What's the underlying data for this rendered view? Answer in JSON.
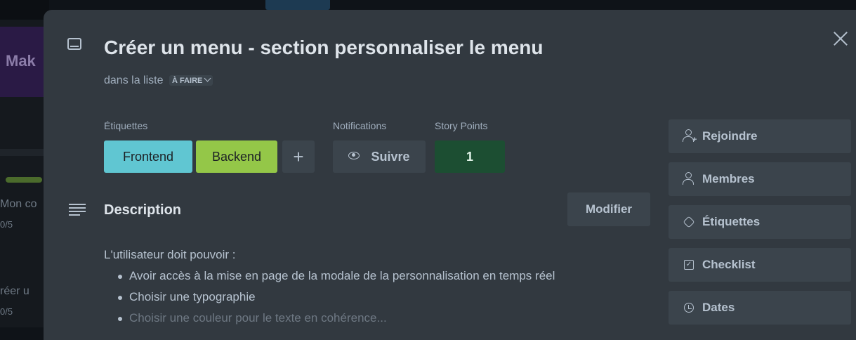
{
  "background": {
    "board_title": "Mak",
    "card1_title": "Mon co",
    "card1_count": "0/5",
    "card2_title": "réer u",
    "card2_count": "0/5"
  },
  "card": {
    "title": "Créer un menu - section personnaliser le menu",
    "in_list_prefix": "dans la liste",
    "list_name": "À FAIRE"
  },
  "labels_section": {
    "heading": "Étiquettes",
    "labels": [
      {
        "text": "Frontend",
        "color": "#60c6d2"
      },
      {
        "text": "Backend",
        "color": "#94c748"
      }
    ],
    "add_symbol": "+"
  },
  "notifications": {
    "heading": "Notifications",
    "follow_label": "Suivre"
  },
  "story_points": {
    "heading": "Story Points",
    "value": "1"
  },
  "description": {
    "heading": "Description",
    "edit_label": "Modifier",
    "intro": "L'utilisateur doit pouvoir :",
    "items": [
      "Avoir accès à la mise en page de la modale de la personnalisation en temps réel",
      "Choisir une typographie",
      "Choisir une couleur pour le texte en cohérence..."
    ]
  },
  "sidebar": {
    "buttons": [
      {
        "label": "Rejoindre",
        "icon": "user-plus-icon"
      },
      {
        "label": "Membres",
        "icon": "user-icon"
      },
      {
        "label": "Étiquettes",
        "icon": "tag-icon"
      },
      {
        "label": "Checklist",
        "icon": "checklist-icon"
      },
      {
        "label": "Dates",
        "icon": "clock-icon"
      }
    ]
  },
  "colors": {
    "modal_bg": "#323940",
    "button_bg": "#3b444c",
    "story_points_bg": "#1c4e32"
  }
}
